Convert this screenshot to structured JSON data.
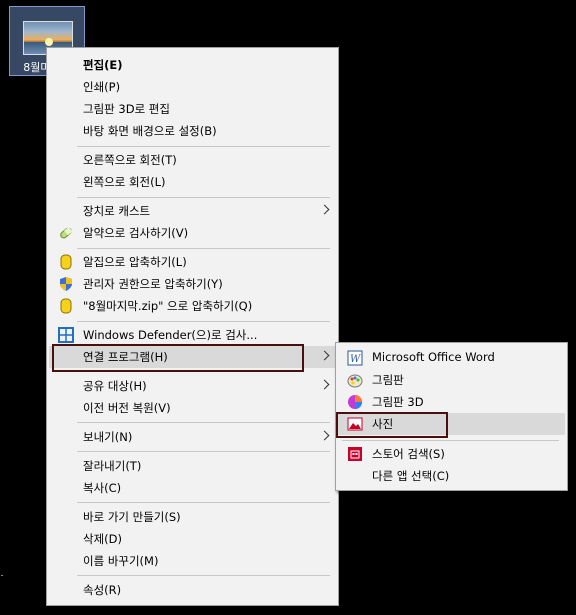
{
  "desktop": {
    "file_label": "8월마지막"
  },
  "context_menu": {
    "items": [
      {
        "label": "편집(E)",
        "bold": true
      },
      {
        "label": "인쇄(P)"
      },
      {
        "label": "그림판 3D로 편집"
      },
      {
        "label": "바탕 화면 배경으로 설정(B)"
      },
      {
        "label": "오른쪽으로 회전(T)"
      },
      {
        "label": "왼쪽으로 회전(L)"
      },
      {
        "label": "장치로 캐스트",
        "submenu": true
      },
      {
        "label": "알약으로 검사하기(V)",
        "icon": "alyac-pill-icon"
      },
      {
        "label": "알집으로 압축하기(L)",
        "icon": "alzip-icon"
      },
      {
        "label": "관리자 권한으로 압축하기(Y)",
        "icon": "admin-shield-icon"
      },
      {
        "label": "\"8월마지막.zip\" 으로 압축하기(Q)",
        "icon": "alzip-icon"
      },
      {
        "label": "Windows Defender(으)로 검사...",
        "icon": "windows-defender-icon"
      },
      {
        "label": "연결 프로그램(H)",
        "submenu": true
      },
      {
        "label": "공유 대상(H)",
        "submenu": true
      },
      {
        "label": "이전 버전 복원(V)"
      },
      {
        "label": "보내기(N)",
        "submenu": true
      },
      {
        "label": "잘라내기(T)"
      },
      {
        "label": "복사(C)"
      },
      {
        "label": "바로 가기 만들기(S)"
      },
      {
        "label": "삭제(D)"
      },
      {
        "label": "이름 바꾸기(M)"
      },
      {
        "label": "속성(R)"
      }
    ]
  },
  "open_with_submenu": {
    "items": [
      {
        "label": "Microsoft Office Word",
        "icon": "word-icon"
      },
      {
        "label": "그림판",
        "icon": "paint-icon"
      },
      {
        "label": "그림판 3D",
        "icon": "paint3d-icon"
      },
      {
        "label": "사진",
        "icon": "photos-icon"
      },
      {
        "label": "스토어 검색(S)",
        "icon": "store-icon"
      },
      {
        "label": "다른 앱 선택(C)"
      }
    ]
  },
  "colors": {
    "highlight": "#d9d9d9",
    "outline": "#4a1010",
    "menu_bg": "#f2f2f2"
  }
}
